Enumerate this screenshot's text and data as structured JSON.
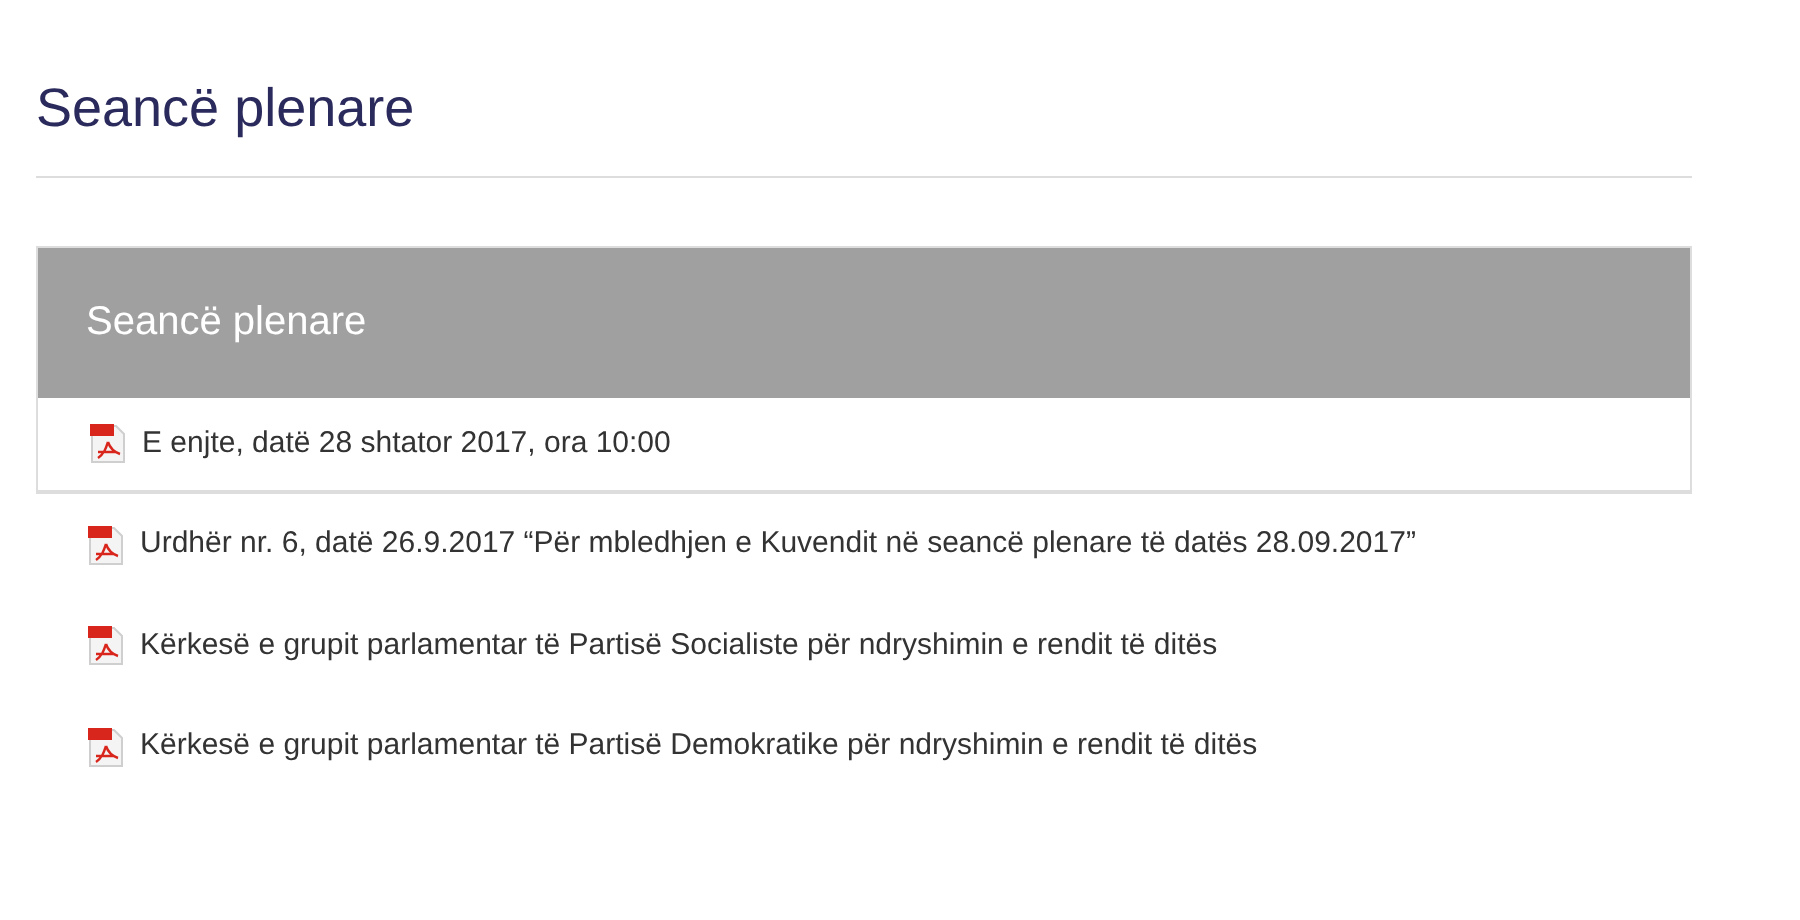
{
  "page_title": "Seancë plenare",
  "panel": {
    "title": "Seancë plenare",
    "session": {
      "text": "E enjte, datë 28 shtator 2017, ora 10:00"
    },
    "documents": [
      {
        "text": "Urdhër nr. 6, datë 26.9.2017 “Për mbledhjen e Kuvendit në seancë plenare të datës 28.09.2017”"
      },
      {
        "text": "Kërkesë e grupit parlamentar të Partisë Socialiste për ndryshimin e rendit të ditës"
      },
      {
        "text": "Kërkesë e grupit parlamentar të Partisë Demokratike për ndryshimin e rendit të ditës"
      }
    ]
  }
}
